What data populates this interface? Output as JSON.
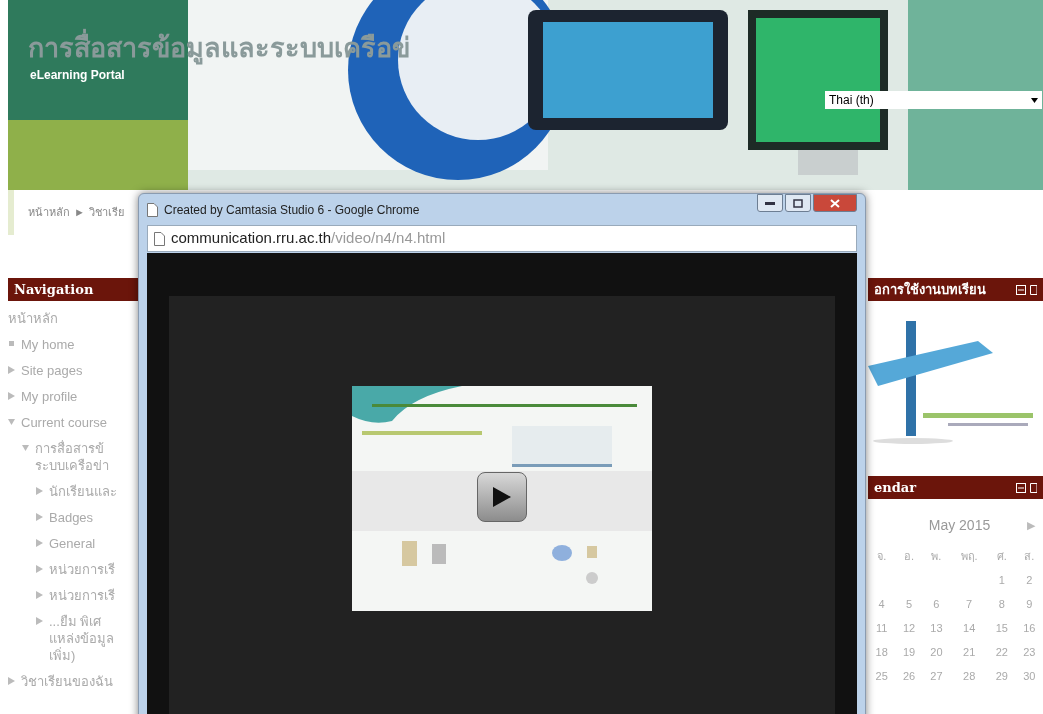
{
  "header": {
    "site_title": "การสื่อสารข้อมูลและระบบเครือข่",
    "subtitle": "eLearning Portal",
    "language_select": {
      "value": "Thai (th)"
    }
  },
  "breadcrumb": {
    "separator": "►",
    "items": [
      "หน้าหลัก",
      "วิชาเรีย"
    ]
  },
  "navigation": {
    "title": "Navigation",
    "items": [
      {
        "label": "หน้าหลัก",
        "kind": "root"
      },
      {
        "label": "My home",
        "kind": "leaf"
      },
      {
        "label": "Site pages",
        "kind": "branch",
        "expanded": false
      },
      {
        "label": "My profile",
        "kind": "branch",
        "expanded": false
      },
      {
        "label": "Current course",
        "kind": "branch",
        "expanded": true,
        "children": [
          {
            "label": "การสื่อสารข้\nระบบเครือข่า",
            "kind": "branch",
            "expanded": true,
            "children": [
              {
                "label": "นักเรียนและ",
                "kind": "branch",
                "expanded": false
              },
              {
                "label": "Badges",
                "kind": "branch",
                "expanded": false
              },
              {
                "label": "General",
                "kind": "branch",
                "expanded": false
              },
              {
                "label": "หน่วยการเรี",
                "kind": "branch",
                "expanded": false
              },
              {
                "label": "หน่วยการเรี",
                "kind": "branch",
                "expanded": false
              },
              {
                "label": "...ยืม พิเศ\nแหล่งข้อมูล\nเพิ่ม)",
                "kind": "branch",
                "expanded": false
              }
            ]
          }
        ]
      },
      {
        "label": "วิชาเรียนของฉัน",
        "kind": "branch",
        "expanded": false
      }
    ]
  },
  "manual_block": {
    "title": "อการใช้งานบทเรียน"
  },
  "calendar": {
    "title": "endar",
    "month": "May 2015",
    "next": "▶",
    "weekdays": [
      "จ.",
      "อ.",
      "พ.",
      "พฤ.",
      "ศ.",
      "ส."
    ],
    "weeks": [
      [
        "1",
        "2"
      ],
      [
        "4",
        "5",
        "6",
        "7",
        "8",
        "9"
      ],
      [
        "11",
        "12",
        "13",
        "14",
        "15",
        "16"
      ],
      [
        "18",
        "19",
        "20",
        "21",
        "22",
        "23"
      ],
      [
        "25",
        "26",
        "27",
        "28",
        "29",
        "30"
      ]
    ]
  },
  "popup": {
    "title": "Created by Camtasia Studio 6 - Google Chrome",
    "url_host": "communication.rru.ac.th",
    "url_path": "/video/n4/n4.html"
  }
}
